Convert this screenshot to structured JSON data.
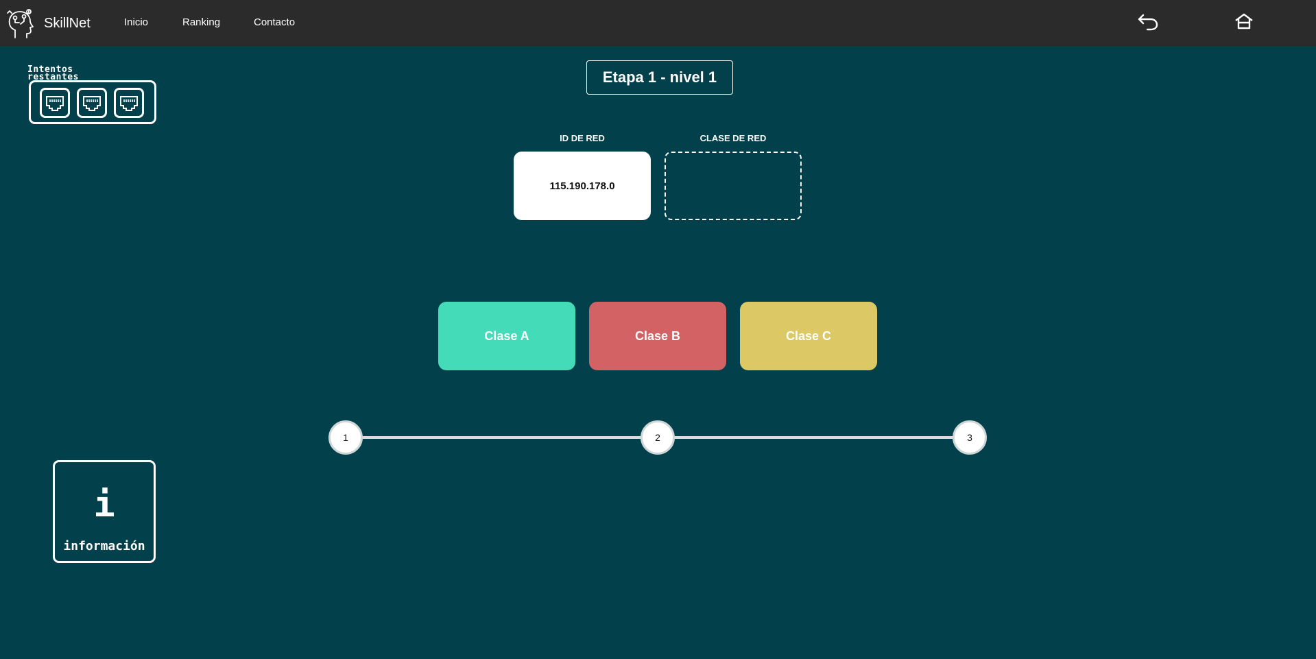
{
  "navbar": {
    "brand_name": "SkillNet",
    "links": [
      "Inicio",
      "Ranking",
      "Contacto"
    ],
    "back_icon": "undo-arrow-icon",
    "home_icon": "home-icon"
  },
  "attempts": {
    "label": "Intentos restantes",
    "remaining": 3,
    "icon": "ethernet-port-icon"
  },
  "level": {
    "title": "Etapa 1 - nivel 1"
  },
  "network": {
    "id_label": "ID DE RED",
    "id_value": "115.190.178.0",
    "class_label": "CLASE DE RED",
    "class_value": ""
  },
  "options": [
    {
      "label": "Clase A",
      "color": "#43dbb8"
    },
    {
      "label": "Clase B",
      "color": "#d26263"
    },
    {
      "label": "Clase C",
      "color": "#dcc966"
    }
  ],
  "progress": {
    "steps": [
      "1",
      "2",
      "3"
    ]
  },
  "info": {
    "glyph": "i",
    "label": "información"
  },
  "colors": {
    "background": "#02414b",
    "navbar": "#2b2b2b"
  }
}
